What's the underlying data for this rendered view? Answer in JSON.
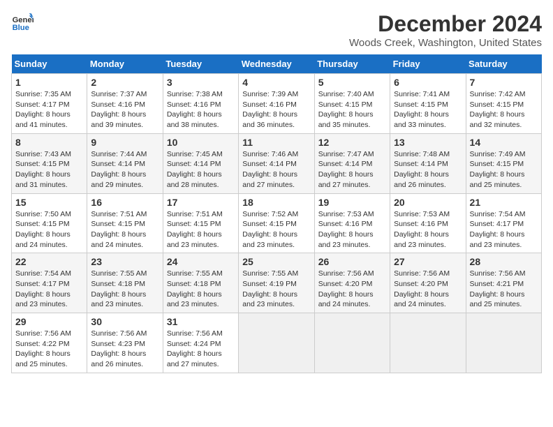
{
  "logo": {
    "line1": "General",
    "line2": "Blue"
  },
  "title": "December 2024",
  "subtitle": "Woods Creek, Washington, United States",
  "days_of_week": [
    "Sunday",
    "Monday",
    "Tuesday",
    "Wednesday",
    "Thursday",
    "Friday",
    "Saturday"
  ],
  "weeks": [
    [
      {
        "day": "1",
        "sunrise": "7:35 AM",
        "sunset": "4:17 PM",
        "daylight": "8 hours and 41 minutes."
      },
      {
        "day": "2",
        "sunrise": "7:37 AM",
        "sunset": "4:16 PM",
        "daylight": "8 hours and 39 minutes."
      },
      {
        "day": "3",
        "sunrise": "7:38 AM",
        "sunset": "4:16 PM",
        "daylight": "8 hours and 38 minutes."
      },
      {
        "day": "4",
        "sunrise": "7:39 AM",
        "sunset": "4:16 PM",
        "daylight": "8 hours and 36 minutes."
      },
      {
        "day": "5",
        "sunrise": "7:40 AM",
        "sunset": "4:15 PM",
        "daylight": "8 hours and 35 minutes."
      },
      {
        "day": "6",
        "sunrise": "7:41 AM",
        "sunset": "4:15 PM",
        "daylight": "8 hours and 33 minutes."
      },
      {
        "day": "7",
        "sunrise": "7:42 AM",
        "sunset": "4:15 PM",
        "daylight": "8 hours and 32 minutes."
      }
    ],
    [
      {
        "day": "8",
        "sunrise": "7:43 AM",
        "sunset": "4:15 PM",
        "daylight": "8 hours and 31 minutes."
      },
      {
        "day": "9",
        "sunrise": "7:44 AM",
        "sunset": "4:14 PM",
        "daylight": "8 hours and 29 minutes."
      },
      {
        "day": "10",
        "sunrise": "7:45 AM",
        "sunset": "4:14 PM",
        "daylight": "8 hours and 28 minutes."
      },
      {
        "day": "11",
        "sunrise": "7:46 AM",
        "sunset": "4:14 PM",
        "daylight": "8 hours and 27 minutes."
      },
      {
        "day": "12",
        "sunrise": "7:47 AM",
        "sunset": "4:14 PM",
        "daylight": "8 hours and 27 minutes."
      },
      {
        "day": "13",
        "sunrise": "7:48 AM",
        "sunset": "4:14 PM",
        "daylight": "8 hours and 26 minutes."
      },
      {
        "day": "14",
        "sunrise": "7:49 AM",
        "sunset": "4:15 PM",
        "daylight": "8 hours and 25 minutes."
      }
    ],
    [
      {
        "day": "15",
        "sunrise": "7:50 AM",
        "sunset": "4:15 PM",
        "daylight": "8 hours and 24 minutes."
      },
      {
        "day": "16",
        "sunrise": "7:51 AM",
        "sunset": "4:15 PM",
        "daylight": "8 hours and 24 minutes."
      },
      {
        "day": "17",
        "sunrise": "7:51 AM",
        "sunset": "4:15 PM",
        "daylight": "8 hours and 23 minutes."
      },
      {
        "day": "18",
        "sunrise": "7:52 AM",
        "sunset": "4:15 PM",
        "daylight": "8 hours and 23 minutes."
      },
      {
        "day": "19",
        "sunrise": "7:53 AM",
        "sunset": "4:16 PM",
        "daylight": "8 hours and 23 minutes."
      },
      {
        "day": "20",
        "sunrise": "7:53 AM",
        "sunset": "4:16 PM",
        "daylight": "8 hours and 23 minutes."
      },
      {
        "day": "21",
        "sunrise": "7:54 AM",
        "sunset": "4:17 PM",
        "daylight": "8 hours and 23 minutes."
      }
    ],
    [
      {
        "day": "22",
        "sunrise": "7:54 AM",
        "sunset": "4:17 PM",
        "daylight": "8 hours and 23 minutes."
      },
      {
        "day": "23",
        "sunrise": "7:55 AM",
        "sunset": "4:18 PM",
        "daylight": "8 hours and 23 minutes."
      },
      {
        "day": "24",
        "sunrise": "7:55 AM",
        "sunset": "4:18 PM",
        "daylight": "8 hours and 23 minutes."
      },
      {
        "day": "25",
        "sunrise": "7:55 AM",
        "sunset": "4:19 PM",
        "daylight": "8 hours and 23 minutes."
      },
      {
        "day": "26",
        "sunrise": "7:56 AM",
        "sunset": "4:20 PM",
        "daylight": "8 hours and 24 minutes."
      },
      {
        "day": "27",
        "sunrise": "7:56 AM",
        "sunset": "4:20 PM",
        "daylight": "8 hours and 24 minutes."
      },
      {
        "day": "28",
        "sunrise": "7:56 AM",
        "sunset": "4:21 PM",
        "daylight": "8 hours and 25 minutes."
      }
    ],
    [
      {
        "day": "29",
        "sunrise": "7:56 AM",
        "sunset": "4:22 PM",
        "daylight": "8 hours and 25 minutes."
      },
      {
        "day": "30",
        "sunrise": "7:56 AM",
        "sunset": "4:23 PM",
        "daylight": "8 hours and 26 minutes."
      },
      {
        "day": "31",
        "sunrise": "7:56 AM",
        "sunset": "4:24 PM",
        "daylight": "8 hours and 27 minutes."
      },
      null,
      null,
      null,
      null
    ]
  ]
}
